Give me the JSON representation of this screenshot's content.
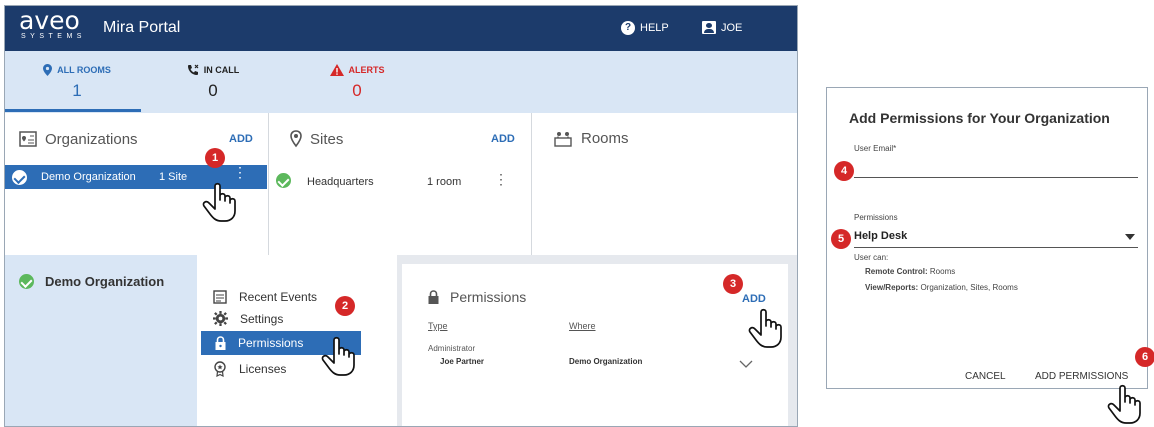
{
  "header": {
    "logo_text": "aveo",
    "logo_subtext": "SYSTEMS",
    "title": "Mira Portal",
    "help_label": "HELP",
    "user_label": "JOE"
  },
  "status": {
    "all_rooms_label": "ALL ROOMS",
    "all_rooms_value": "1",
    "in_call_label": "IN CALL",
    "in_call_value": "0",
    "alerts_label": "ALERTS",
    "alerts_value": "0"
  },
  "organizations": {
    "title": "Organizations",
    "add_label": "ADD",
    "row_name": "Demo Organization",
    "row_count": "1 Site"
  },
  "sites": {
    "title": "Sites",
    "add_label": "ADD",
    "row_name": "Headquarters",
    "row_count": "1 room"
  },
  "rooms": {
    "title": "Rooms"
  },
  "org_detail": {
    "name": "Demo Organization"
  },
  "menu": {
    "items": [
      {
        "label": "Recent Events",
        "icon": "calendar-icon"
      },
      {
        "label": "Settings",
        "icon": "gear-icon"
      },
      {
        "label": "Permissions",
        "icon": "lock-icon"
      },
      {
        "label": "Licenses",
        "icon": "badge-icon"
      }
    ]
  },
  "permissions": {
    "title": "Permissions",
    "add_label": "ADD",
    "col_type": "Type",
    "col_where": "Where",
    "role": "Administrator",
    "user": "Joe Partner",
    "where": "Demo Organization"
  },
  "dialog": {
    "title": "Add Permissions for Your Organization",
    "email_label": "User Email*",
    "email_value": "",
    "permissions_label": "Permissions",
    "permissions_value": "Help Desk",
    "user_can_label": "User can:",
    "remote_label": "Remote Control:",
    "remote_value": "Rooms",
    "view_label": "View/Reports:",
    "view_value": "Organization, Sites, Rooms",
    "cancel_label": "CANCEL",
    "submit_label": "ADD PERMISSIONS"
  },
  "markers": [
    "1",
    "2",
    "3",
    "4",
    "5",
    "6"
  ],
  "colors": {
    "header_bg": "#1c3b6b",
    "status_bg": "#d9e6f5",
    "accent": "#2d6db6",
    "alert": "#d52828",
    "ok": "#5cb85c"
  }
}
